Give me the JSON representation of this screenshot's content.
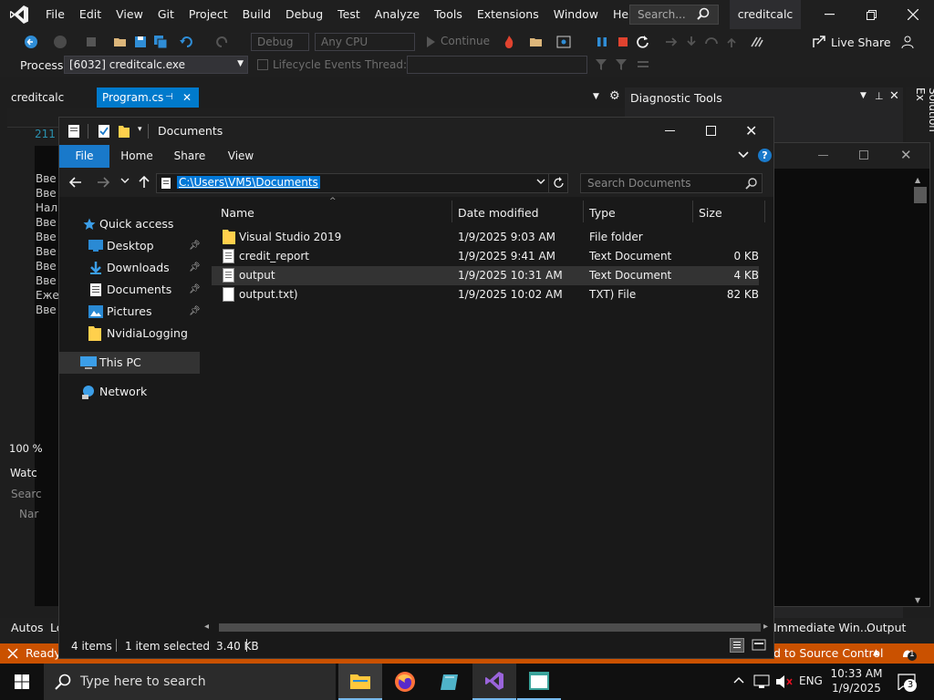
{
  "vs": {
    "menu": [
      "File",
      "Edit",
      "View",
      "Git",
      "Project",
      "Build",
      "Debug",
      "Test",
      "Analyze",
      "Tools",
      "Extensions",
      "Window",
      "Help"
    ],
    "search_placeholder": "Search...",
    "solution_title": "creditcalc",
    "toolbar": {
      "config": "Debug",
      "platform": "Any CPU",
      "continue_label": "Continue",
      "live_share": "Live Share"
    },
    "toolbar2": {
      "process_label": "Process:",
      "process_value": "[6032] creditcalc.exe",
      "lifecycle": "Lifecycle Events",
      "thread": "Thread:"
    },
    "tabs": {
      "left_title": "creditcalc",
      "program_tab": "Program.cs",
      "diag_title": "Diagnostic Tools",
      "solution_explorer_vertical": "Solution Ex"
    },
    "editor_peek": {
      "line_no": "211",
      "lines": [
        "Вве",
        "Вве",
        "Нал",
        "Вве",
        "Вве",
        "Вве",
        "Вве",
        "Вве",
        "Еже",
        "Вве"
      ],
      "zoom": "100 %",
      "watch": "Watc",
      "search": "Searc",
      "name": "Nar",
      "autos": "Autos",
      "locals": "Lo"
    },
    "bottom_tabs": [
      "Immediate Win...",
      "Output"
    ],
    "status": {
      "ready": "Ready",
      "source_control": "d to Source Control",
      "notifications": "1"
    }
  },
  "explorer": {
    "title": "Documents",
    "ribbon_tabs": [
      "File",
      "Home",
      "Share",
      "View"
    ],
    "address": "C:\\Users\\VM5\\Documents",
    "search_placeholder": "Search Documents",
    "nav": {
      "quick_access": "Quick access",
      "items": [
        "Desktop",
        "Downloads",
        "Documents",
        "Pictures",
        "NvidiaLogging"
      ],
      "this_pc": "This PC",
      "network": "Network"
    },
    "columns": [
      "Name",
      "Date modified",
      "Type",
      "Size"
    ],
    "files": [
      {
        "name": "Visual Studio 2019",
        "date": "1/9/2025 9:03 AM",
        "type": "File folder",
        "size": "",
        "icon": "folder-icon"
      },
      {
        "name": "credit_report",
        "date": "1/9/2025 9:41 AM",
        "type": "Text Document",
        "size": "0 KB",
        "icon": "text-file-icon"
      },
      {
        "name": "output",
        "date": "1/9/2025 10:31 AM",
        "type": "Text Document",
        "size": "4 KB",
        "icon": "text-file-icon"
      },
      {
        "name": "output.txt)",
        "date": "1/9/2025 10:02 AM",
        "type": "TXT) File",
        "size": "82 KB",
        "icon": "file-icon"
      }
    ],
    "selected_row": 2,
    "status": {
      "items": "4 items",
      "selected": "1 item selected",
      "size": "3.40 KB"
    }
  },
  "taskbar": {
    "search_placeholder": "Type here to search",
    "lang": "ENG",
    "time": "10:33 AM",
    "date": "1/9/2025",
    "notif_count": "3"
  },
  "colors": {
    "vs_accent": "#007acc",
    "status_orange": "#ca5100",
    "ribbon_file": "#1979ca",
    "selection": "#0078d7"
  }
}
